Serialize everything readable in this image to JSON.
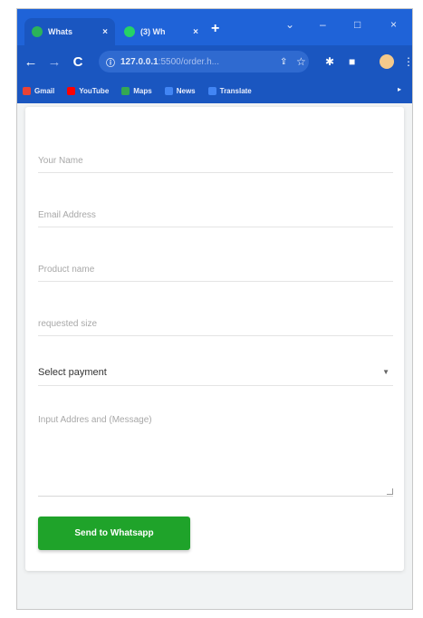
{
  "browser": {
    "tabs": [
      {
        "title": "Whats",
        "close": "×",
        "favicon_color": "#2bb35a"
      },
      {
        "title": "(3) Wh",
        "close": "×",
        "favicon_color": "#25d366"
      }
    ],
    "new_tab": "+",
    "window_controls": {
      "chevron": "⌄",
      "minimize": "–",
      "maximize": "□",
      "close": "×"
    },
    "nav": {
      "back": "←",
      "forward": "→",
      "reload": "C"
    },
    "address": {
      "host": "127.0.0.1",
      "path": ":5500/order.h..."
    },
    "bookmarks": [
      {
        "label": "Gmail",
        "color": "#ea4335"
      },
      {
        "label": "YouTube",
        "color": "#ff0000"
      },
      {
        "label": "Maps",
        "color": "#34a853"
      },
      {
        "label": "News",
        "color": "#4285f4"
      },
      {
        "label": "Translate",
        "color": "#4285f4"
      }
    ]
  },
  "form": {
    "name_placeholder": "Your Name",
    "email_placeholder": "Email Address",
    "product_placeholder": "Product name",
    "size_placeholder": "requested size",
    "payment_selected": "Select payment",
    "message_placeholder": "Input Addres and (Message)",
    "submit_label": "Send to Whatsapp"
  },
  "colors": {
    "browser_accent": "#1a56c0",
    "submit_button": "#1fa32a"
  }
}
